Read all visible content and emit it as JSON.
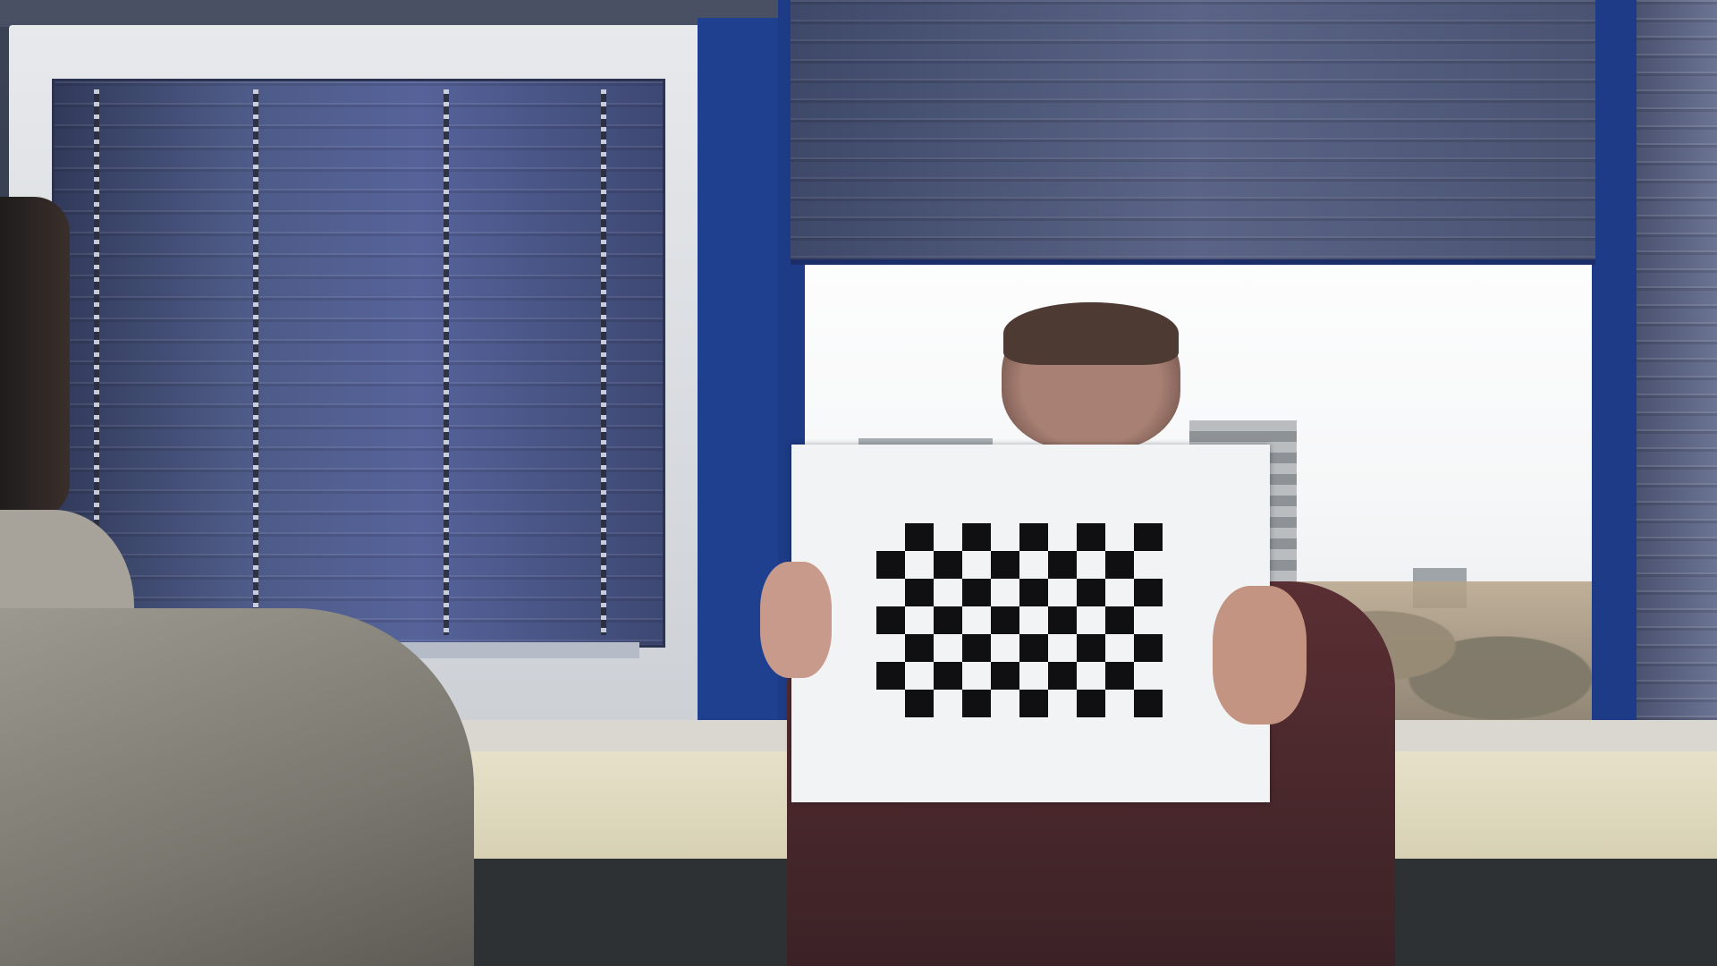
{
  "scene": {
    "description_type": "photograph",
    "colors": {
      "window_frame": "#1f3f8f",
      "blind": "#4d5a86",
      "sky": "#f6f7f8",
      "board": "#f2f3f4",
      "checker": "#101012"
    },
    "checkerboard": {
      "rows": 7,
      "columns": 10
    }
  }
}
